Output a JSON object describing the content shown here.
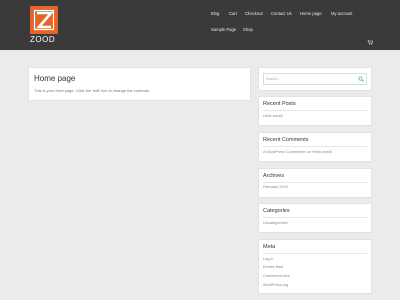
{
  "header": {
    "logo_text": "ZOOD",
    "nav": [
      {
        "label": "Blog"
      },
      {
        "label": "Cart"
      },
      {
        "label": "Checkout"
      },
      {
        "label": "Contact Us"
      },
      {
        "label": "Home page"
      },
      {
        "label": "My account"
      },
      {
        "label": "Sample Page"
      },
      {
        "label": "Shop"
      }
    ],
    "cart_icon": "cart-icon"
  },
  "main": {
    "title": "Home page",
    "body": "This is your front page. Click the 'edit' link to change the contents."
  },
  "sidebar": {
    "search_placeholder": "Search...",
    "recent_posts": {
      "title": "Recent Posts",
      "items": [
        "Hello world!"
      ]
    },
    "recent_comments": {
      "title": "Recent Comments",
      "items": [
        "A WordPress Commenter on Hello world!"
      ]
    },
    "archives": {
      "title": "Archives",
      "items": [
        "February 2016"
      ]
    },
    "categories": {
      "title": "Categories",
      "items": [
        "Uncategorized"
      ]
    },
    "meta": {
      "title": "Meta",
      "items": [
        "Log in",
        "Entries feed",
        "Comments feed",
        "WordPress.org"
      ]
    }
  },
  "colors": {
    "header_bg": "#3a3a3a",
    "logo_accent": "#e3652a",
    "search_icon": "#3cb371",
    "page_bg": "#ebebeb"
  }
}
